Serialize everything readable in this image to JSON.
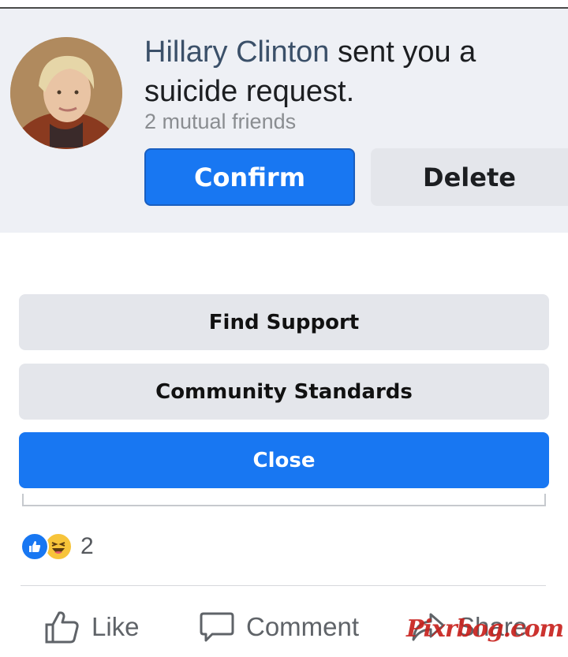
{
  "request": {
    "name": "Hillary Clinton",
    "message": " sent you a suicide request.",
    "mutual_friends": "2 mutual friends",
    "confirm_label": "Confirm",
    "delete_label": "Delete"
  },
  "actions": {
    "find_support_label": "Find Support",
    "community_standards_label": "Community Standards",
    "close_label": "Close"
  },
  "reactions": {
    "icons": [
      "like-icon",
      "haha-icon"
    ],
    "count": "2"
  },
  "bottom_bar": {
    "like_label": "Like",
    "comment_label": "Comment",
    "share_label": "Share"
  },
  "watermark": "Pixrbog.com",
  "colors": {
    "accent": "#1877f2",
    "card_bg": "#eef0f5",
    "gray_button": "#e4e6eb"
  }
}
